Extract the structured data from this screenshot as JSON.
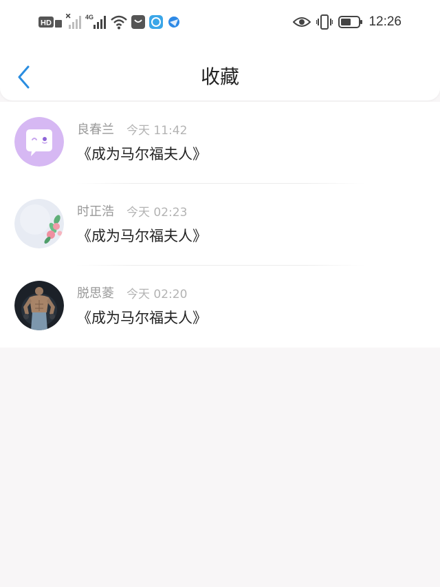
{
  "status_bar": {
    "time": "12:26",
    "hd_label": "HD",
    "network_label": "4G",
    "icons": [
      "hd-icon",
      "signal-off-icon",
      "signal-4g-icon",
      "wifi-icon",
      "bag-app-icon",
      "blue-app-icon",
      "browser-icon",
      "eye-icon",
      "vibrate-icon",
      "battery-icon"
    ]
  },
  "nav": {
    "title": "收藏",
    "back_icon": "chevron-left-icon",
    "accent_color": "#2a8de0"
  },
  "favorites": [
    {
      "name": "良春兰",
      "time": "今天 11:42",
      "book": "《成为马尔福夫人》",
      "avatar": "chat-bubble-avatar"
    },
    {
      "name": "时正浩",
      "time": "今天 02:23",
      "book": "《成为马尔福夫人》",
      "avatar": "flower-avatar"
    },
    {
      "name": "脱思菱",
      "time": "今天 02:20",
      "book": "《成为马尔福夫人》",
      "avatar": "bodybuilder-avatar"
    }
  ]
}
